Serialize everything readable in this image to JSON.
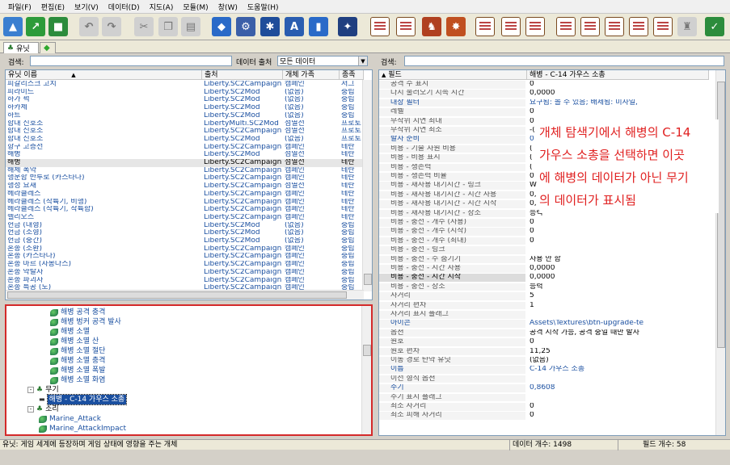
{
  "menu": [
    "파일(F)",
    "편집(E)",
    "보기(V)",
    "데이터(D)",
    "지도(A)",
    "모듈(M)",
    "창(W)",
    "도움말(H)"
  ],
  "tab": {
    "label": "유닛"
  },
  "left": {
    "search_label": "검색:",
    "search_value": "",
    "data_source_label": "데이터 출처",
    "data_source_value": "모든 데이터",
    "columns": [
      "유닛 이름",
      "출처",
      "개체 가족",
      "종족"
    ],
    "rows": [
      [
        "피갈리스크 고치",
        "Liberty.SC2Campaign",
        "캠페인",
        "저그"
      ],
      [
        "피라미드",
        "Liberty.SC2Mod",
        "(없음)",
        "중립"
      ],
      [
        "하가 퍽",
        "Liberty.SC2Mod",
        "(없음)",
        "중립"
      ],
      [
        "하카체",
        "Liberty.SC2Mod",
        "(없음)",
        "중립"
      ],
      [
        "하트",
        "Liberty.SC2Mod",
        "(없음)",
        "중립"
      ],
      [
        "함대 신호소",
        "LibertyMulti.SC2Mod",
        "섬멸전",
        "프로토"
      ],
      [
        "함대 신호소",
        "Liberty.SC2Campaign",
        "섬멸전",
        "프로토"
      ],
      [
        "함대 신호소",
        "Liberty.SC2Mod",
        "(없음)",
        "프로토"
      ],
      [
        "항구 고층선",
        "Liberty.SC2Campaign",
        "캠페인",
        "테란"
      ],
      [
        "해병",
        "Liberty.SC2Mod",
        "섬멸전",
        "테란"
      ],
      [
        "해병",
        "Liberty.SC2Campaign",
        "섬멸전",
        "테란"
      ],
      [
        "해체 폭약",
        "Liberty.SC2Campaign",
        "캠페인",
        "테란"
      ],
      [
        "행운함 반투로 (카스타나)",
        "Liberty.SC2Campaign",
        "캠페인",
        "테란"
      ],
      [
        "행성 요새",
        "Liberty.SC2Campaign",
        "섬멸전",
        "테란"
      ],
      [
        "헤라클레스",
        "Liberty.SC2Campaign",
        "캠페인",
        "테란"
      ],
      [
        "헤라클레스 (착륙기, 비행)",
        "Liberty.SC2Campaign",
        "캠페인",
        "테란"
      ],
      [
        "헤라클레스 (착륙기, 착륙함)",
        "Liberty.SC2Campaign",
        "캠페인",
        "테란"
      ],
      [
        "헬리오스",
        "Liberty.SC2Campaign",
        "캠페인",
        "테란"
      ],
      [
        "헌금 (대형)",
        "Liberty.SC2Mod",
        "(없음)",
        "중립"
      ],
      [
        "헌금 (소형)",
        "Liberty.SC2Mod",
        "(없음)",
        "중립"
      ],
      [
        "헌금 (중간)",
        "Liberty.SC2Mod",
        "(없음)",
        "중립"
      ],
      [
        "혼종 (소환)",
        "Liberty.SC2Campaign",
        "캠페인",
        "중립"
      ],
      [
        "혼종 (카스타나)",
        "Liberty.SC2Campaign",
        "캠페인",
        "중립"
      ],
      [
        "혼종 마르 (자몽다스)",
        "Liberty.SC2Campaign",
        "캠페인",
        "중립"
      ],
      [
        "혼종 약탈자",
        "Liberty.SC2Campaign",
        "캠페인",
        "중립"
      ],
      [
        "혼종 파괴자",
        "Liberty.SC2Campaign",
        "캠페인",
        "중립"
      ],
      [
        "혼종 특공 (도)",
        "Liberty.SC2Campaign",
        "캠페인",
        "중립"
      ]
    ],
    "selected_row": 10,
    "tree": [
      {
        "label": "해병 공격 충격",
        "depth": 3,
        "icon": "leaf"
      },
      {
        "label": "해병 벙커 공격 발사",
        "depth": 3,
        "icon": "leaf"
      },
      {
        "label": "해병 소멸",
        "depth": 3,
        "icon": "leaf"
      },
      {
        "label": "해병 소멸 산",
        "depth": 3,
        "icon": "leaf"
      },
      {
        "label": "해병 소멸 절단",
        "depth": 3,
        "icon": "leaf"
      },
      {
        "label": "해병 소멸 충격",
        "depth": 3,
        "icon": "leaf"
      },
      {
        "label": "해병 소멸 폭발",
        "depth": 3,
        "icon": "leaf"
      },
      {
        "label": "해병 소멸 화염",
        "depth": 3,
        "icon": "leaf"
      },
      {
        "label": "무기",
        "depth": 1,
        "icon": "folder",
        "expander": "-"
      },
      {
        "label": "해병 - C-14 가우스 소총",
        "depth": 2,
        "icon": "gun",
        "selected": true
      },
      {
        "label": "소리",
        "depth": 1,
        "icon": "folder",
        "expander": "-"
      },
      {
        "label": "Marine_Attack",
        "depth": 2,
        "icon": "leaf"
      },
      {
        "label": "Marine_AttackImpact",
        "depth": 2,
        "icon": "leaf"
      }
    ]
  },
  "right": {
    "search_label": "검색:",
    "search_value": "",
    "columns": [
      "필드",
      "해병 - C-14 가우스 소총"
    ],
    "rows": [
      [
        "공격 수 표시",
        "0",
        false
      ],
      [
        "다시 불러오기 지속 시간",
        "0,0000",
        false
      ],
      [
        "대상 필터",
        "요구됨: 볼 수 있음; 배제됨: 미사일,",
        true
      ],
      [
        "레벨",
        "0",
        false
      ],
      [
        "무작위 지연 최대",
        "0",
        false
      ],
      [
        "무작위 지연 최소",
        "-(",
        false
      ],
      [
        "발사 준비",
        "0",
        true
      ],
      [
        "비용 - 기술 자원 비용",
        "(",
        false
      ],
      [
        "비용 - 비용 표시",
        "(",
        false
      ],
      [
        "비용 - 생존력",
        "(",
        false
      ],
      [
        "비용 - 생존력 비율",
        "0",
        false
      ],
      [
        "비용 - 재사용 대기시간 - 링크",
        "W",
        false
      ],
      [
        "비용 - 재사용 대기시간 - 시간 사용",
        "0,",
        false
      ],
      [
        "비용 - 재사용 대기시간 - 시간 시작",
        "0,",
        false
      ],
      [
        "비용 - 재사용 대기시간 - 장소",
        "능력",
        false
      ],
      [
        "비용 - 충전 - 개수 (사용)",
        "0",
        false
      ],
      [
        "비용 - 충전 - 개수 (시작)",
        "0",
        false
      ],
      [
        "비용 - 충전 - 개수 (최대)",
        "0",
        false
      ],
      [
        "비용 - 충전 - 링크",
        "",
        false
      ],
      [
        "비용 - 충전 - 수 숨기기",
        "사용 안 함",
        false
      ],
      [
        "비용 - 충전 - 시간 사용",
        "0,0000",
        false
      ],
      [
        "비용 - 충전 - 시간 시작",
        "0,0000",
        false
      ],
      [
        "비용 - 충전 - 장소",
        "능력",
        false
      ],
      [
        "사거리",
        "5",
        false
      ],
      [
        "사거리 편차",
        "1",
        false
      ],
      [
        "사거리 표시 플래그",
        "",
        false
      ],
      [
        "아이콘",
        "Assets\\Textures\\btn-upgrade-te",
        true
      ],
      [
        "옵션",
        "공격 시작 가능, 공격 중일 때만 발사",
        false
      ],
      [
        "원호",
        "0",
        false
      ],
      [
        "원호 편차",
        "11,25",
        false
      ],
      [
        "이동 경로 탄약 유닛",
        "(없음)",
        false
      ],
      [
        "이름",
        "C-14 가우스 소총",
        true
      ],
      [
        "이전 형식 옵션",
        "",
        false
      ],
      [
        "주기",
        "0,8608",
        true
      ],
      [
        "주기 표시 플래그",
        "",
        false
      ],
      [
        "최소 사거리",
        "0",
        false
      ],
      [
        "최소 피해 사거리",
        "0",
        false
      ]
    ],
    "selected_row": 21
  },
  "annotation": {
    "lines": [
      "개체 탐색기에서 해병의 C-14",
      "가우스 소총을 선택하면 이곳",
      "에 해병의 데이터가 아닌 무기",
      "의 데이터가 표시됨"
    ],
    "color": "#e02020"
  },
  "status": {
    "description": "유닛: 게임 세계에 등장하며 게임 상태에 영향을 주는 개체",
    "data_count": "데이터 개수: 1498",
    "field_count": "필드 개수: 58"
  },
  "colors": {
    "highlight_border": "#d42a2a",
    "link_blue": "#1a4fa0"
  }
}
